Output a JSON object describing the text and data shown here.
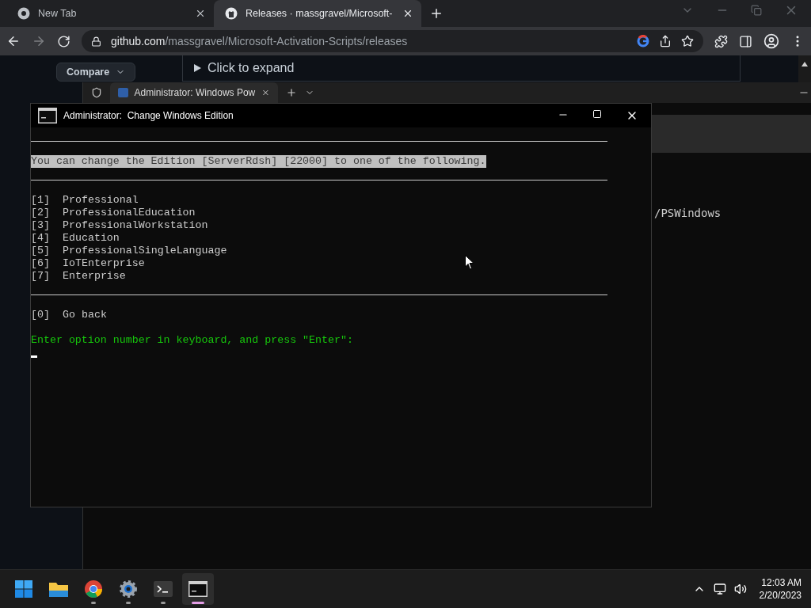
{
  "browser": {
    "tabs": [
      {
        "title": "New Tab",
        "kind": "chrome",
        "selected": false
      },
      {
        "title": "Releases · massgravel/Microsoft-",
        "kind": "github",
        "selected": true
      }
    ],
    "address": {
      "domain": "github.com",
      "path": "/massgravel/Microsoft-Activation-Scripts/releases"
    },
    "content": {
      "compare_button": "Compare",
      "expand_label": "Click to expand"
    }
  },
  "terminal": {
    "tab_title": "Administrator: Windows Pow",
    "output": "/PSWindows"
  },
  "console": {
    "title": "Administrator:  Change Windows Edition",
    "header": "You can change the Edition [ServerRdsh] [22000] to one of the following.",
    "options": [
      {
        "number": "[1]",
        "label": "Professional"
      },
      {
        "number": "[2]",
        "label": "ProfessionalEducation"
      },
      {
        "number": "[3]",
        "label": "ProfessionalWorkstation"
      },
      {
        "number": "[4]",
        "label": "Education"
      },
      {
        "number": "[5]",
        "label": "ProfessionalSingleLanguage"
      },
      {
        "number": "[6]",
        "label": "IoTEnterprise"
      },
      {
        "number": "[7]",
        "label": "Enterprise"
      }
    ],
    "back": {
      "number": "[0]",
      "label": "Go back"
    },
    "prompt": "Enter option number in keyboard, and press \"Enter\":"
  },
  "taskbar": {
    "apps": [
      {
        "kind": "start",
        "running": false,
        "selected": false
      },
      {
        "kind": "explorer",
        "running": false,
        "selected": false
      },
      {
        "kind": "chrome",
        "running": true,
        "selected": false
      },
      {
        "kind": "settings",
        "running": true,
        "selected": false
      },
      {
        "kind": "terminal",
        "running": true,
        "selected": false
      },
      {
        "kind": "console",
        "running": true,
        "selected": true
      }
    ],
    "time": "12:03 AM",
    "date": "2/20/2023"
  }
}
